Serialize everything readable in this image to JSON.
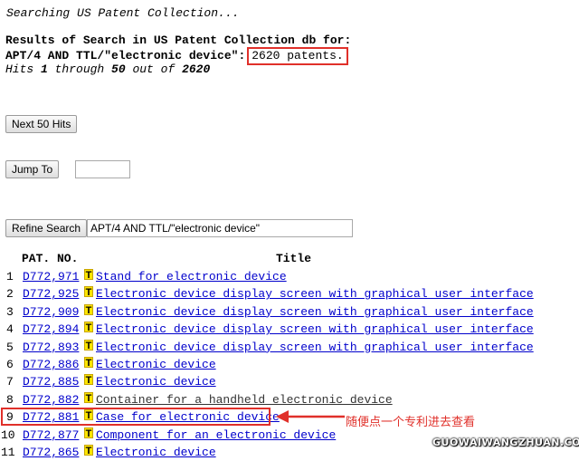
{
  "status": {
    "searching": "Searching US Patent Collection..."
  },
  "results": {
    "title": "Results of Search in US Patent Collection db for:",
    "query": "APT/4 AND TTL/\"electronic device\":",
    "count": "2620 patents.",
    "hits_prefix": "Hits ",
    "hits_from": "1",
    "hits_through": " through ",
    "hits_to": "50",
    "hits_out_of": " out of ",
    "hits_total": "2620"
  },
  "controls": {
    "next_label": "Next 50 Hits",
    "jump_label": "Jump To",
    "jump_value": "",
    "refine_label": "Refine Search",
    "refine_value": "APT/4 AND TTL/\"electronic device\""
  },
  "table": {
    "col_patno": "PAT. NO.",
    "col_title": "Title",
    "rows": [
      {
        "num": "1",
        "patno": "D772,971",
        "title": "Stand for electronic device"
      },
      {
        "num": "2",
        "patno": "D772,925",
        "title": "Electronic device display screen with graphical user interface"
      },
      {
        "num": "3",
        "patno": "D772,909",
        "title": "Electronic device display screen with graphical user interface"
      },
      {
        "num": "4",
        "patno": "D772,894",
        "title": "Electronic device display screen with graphical user interface"
      },
      {
        "num": "5",
        "patno": "D772,893",
        "title": "Electronic device display screen with graphical user interface"
      },
      {
        "num": "6",
        "patno": "D772,886",
        "title": "Electronic device"
      },
      {
        "num": "7",
        "patno": "D772,885",
        "title": "Electronic device"
      },
      {
        "num": "8",
        "patno": "D772,882",
        "title": "Container for a handheld electronic device"
      },
      {
        "num": "9",
        "patno": "D772,881",
        "title": "Case for electronic device"
      },
      {
        "num": "10",
        "patno": "D772,877",
        "title": "Component for an electronic device"
      },
      {
        "num": "11",
        "patno": "D772,865",
        "title": "Electronic device"
      }
    ]
  },
  "annotation": "随便点一个专利进去查看",
  "watermark": "GUOWAIWANGZHUAN.COM",
  "colors": {
    "link": "#0000cc",
    "highlight": "#e0302a",
    "t_icon": "#ffe600"
  }
}
